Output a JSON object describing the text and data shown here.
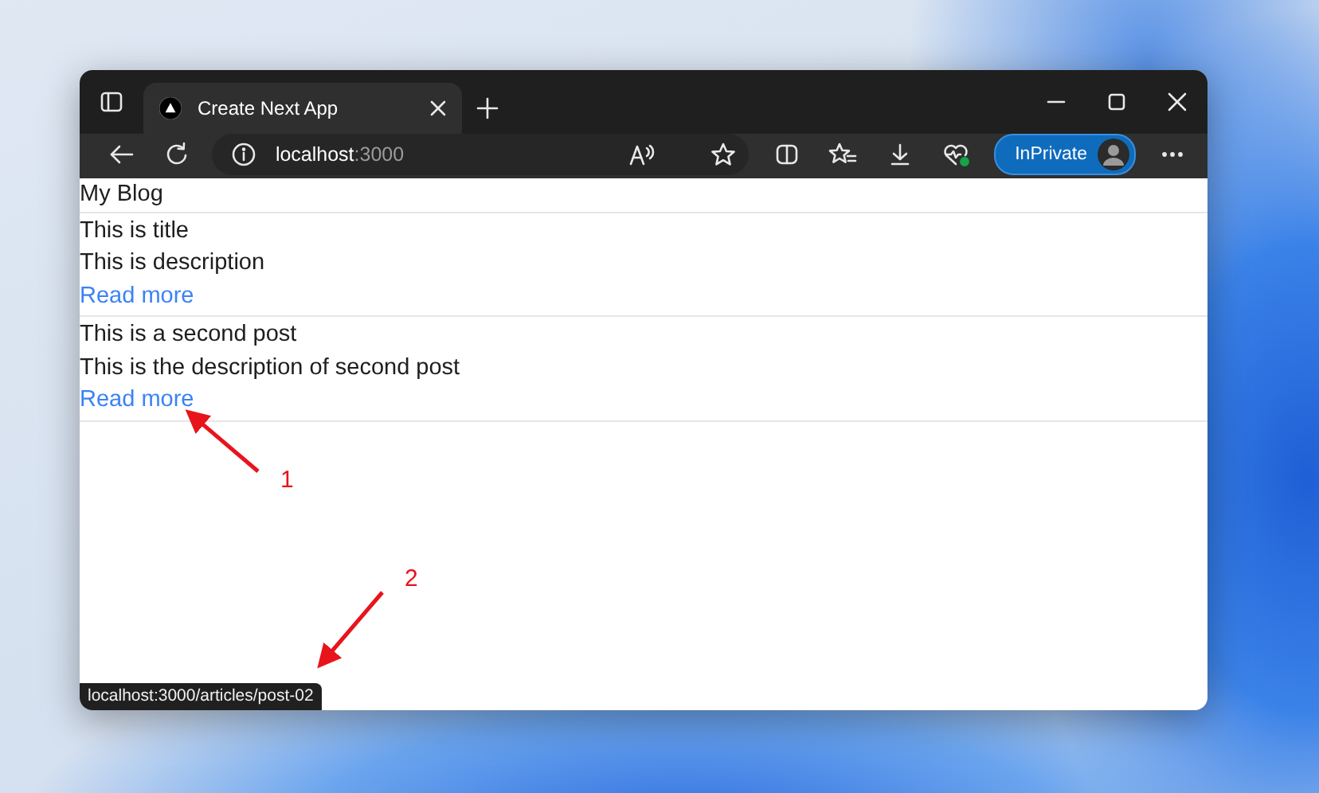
{
  "browser": {
    "tabs": [
      {
        "title": "Create Next App",
        "selected": true
      }
    ],
    "address": {
      "host": "localhost",
      "port": ":3000"
    },
    "profile_label": "InPrivate"
  },
  "page": {
    "heading": "My Blog",
    "posts": [
      {
        "title": "This is title",
        "description": "This is description",
        "link": "Read more"
      },
      {
        "title": "This is a second post",
        "description": "This is the description of second post",
        "link": "Read more"
      }
    ]
  },
  "status_url": "localhost:3000/articles/post-02",
  "annotations": [
    {
      "label": "1"
    },
    {
      "label": "2"
    }
  ]
}
